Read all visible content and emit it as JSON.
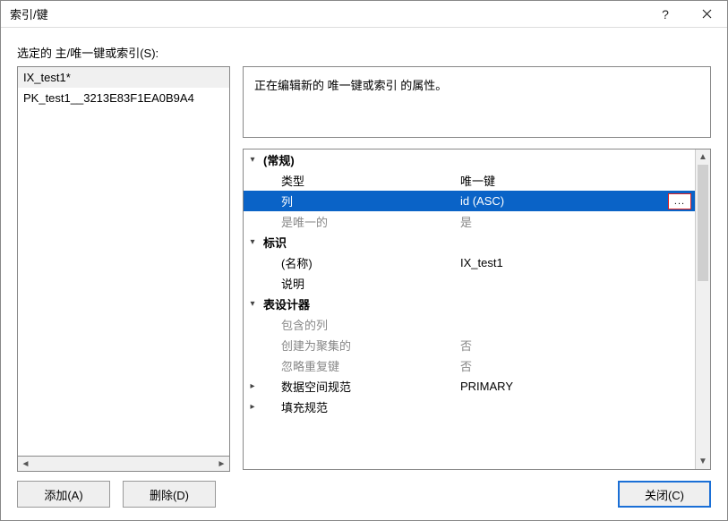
{
  "window": {
    "title": "索引/键"
  },
  "label": {
    "selected": "选定的 主/唯一键或索引(S):"
  },
  "list": {
    "items": [
      "IX_test1*",
      "PK_test1__3213E83F1EA0B9A4"
    ],
    "selected_index": 0
  },
  "buttons": {
    "add": "添加(A)",
    "delete": "删除(D)",
    "close": "关闭(C)"
  },
  "description": "正在编辑新的 唯一键或索引 的属性。",
  "props": {
    "cat_general": "(常规)",
    "type_label": "类型",
    "type_value": "唯一键",
    "columns_label": "列",
    "columns_value": "id (ASC)",
    "is_unique_label": "是唯一的",
    "is_unique_value": "是",
    "cat_identity": "标识",
    "name_label": "(名称)",
    "name_value": "IX_test1",
    "desc_label": "说明",
    "desc_value": "",
    "cat_designer": "表设计器",
    "included_label": "包含的列",
    "included_value": "",
    "clustered_label": "创建为聚集的",
    "clustered_value": "否",
    "ignoredup_label": "忽略重复键",
    "ignoredup_value": "否",
    "dataspace_label": "数据空间规范",
    "dataspace_value": "PRIMARY",
    "fillspec_label": "填充规范",
    "fillspec_value": ""
  },
  "ellipsis": "..."
}
